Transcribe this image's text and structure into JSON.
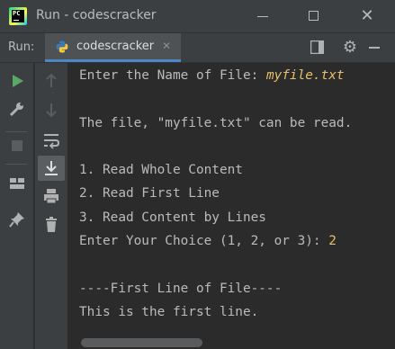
{
  "window": {
    "title": "Run - codescracker"
  },
  "run_panel": {
    "label": "Run:",
    "tab_label": "codescracker"
  },
  "console": {
    "prompt_file": "Enter the Name of File: ",
    "input_file": "myfile.txt",
    "msg_readable": "The file, \"myfile.txt\" can be read.",
    "option1": "1. Read Whole Content",
    "option2": "2. Read First Line",
    "option3": "3. Read Content by Lines",
    "prompt_choice": "Enter Your Choice (1, 2, or 3): ",
    "input_choice": "2",
    "header": "----First Line of File----",
    "output": "This is the first line."
  },
  "colors": {
    "accent": "#4a88c7",
    "input_text": "#e8bf6a",
    "run_green": "#59a869"
  }
}
